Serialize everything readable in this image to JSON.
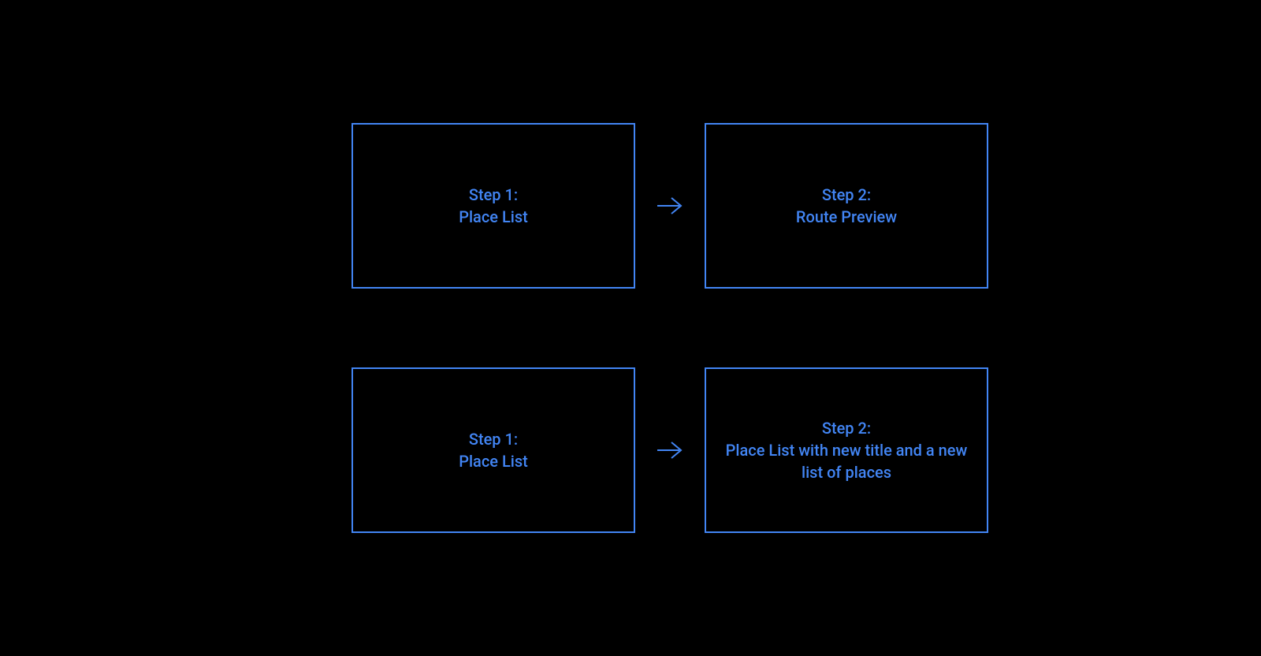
{
  "accent_color": "#4285F4",
  "rows": [
    {
      "step1": {
        "title": "Step 1:",
        "body": "Place List"
      },
      "step2": {
        "title": "Step 2:",
        "body": "Route Preview"
      }
    },
    {
      "step1": {
        "title": "Step 1:",
        "body": "Place List"
      },
      "step2": {
        "title": "Step 2:",
        "body": "Place List with new title and a new list of places"
      }
    }
  ]
}
